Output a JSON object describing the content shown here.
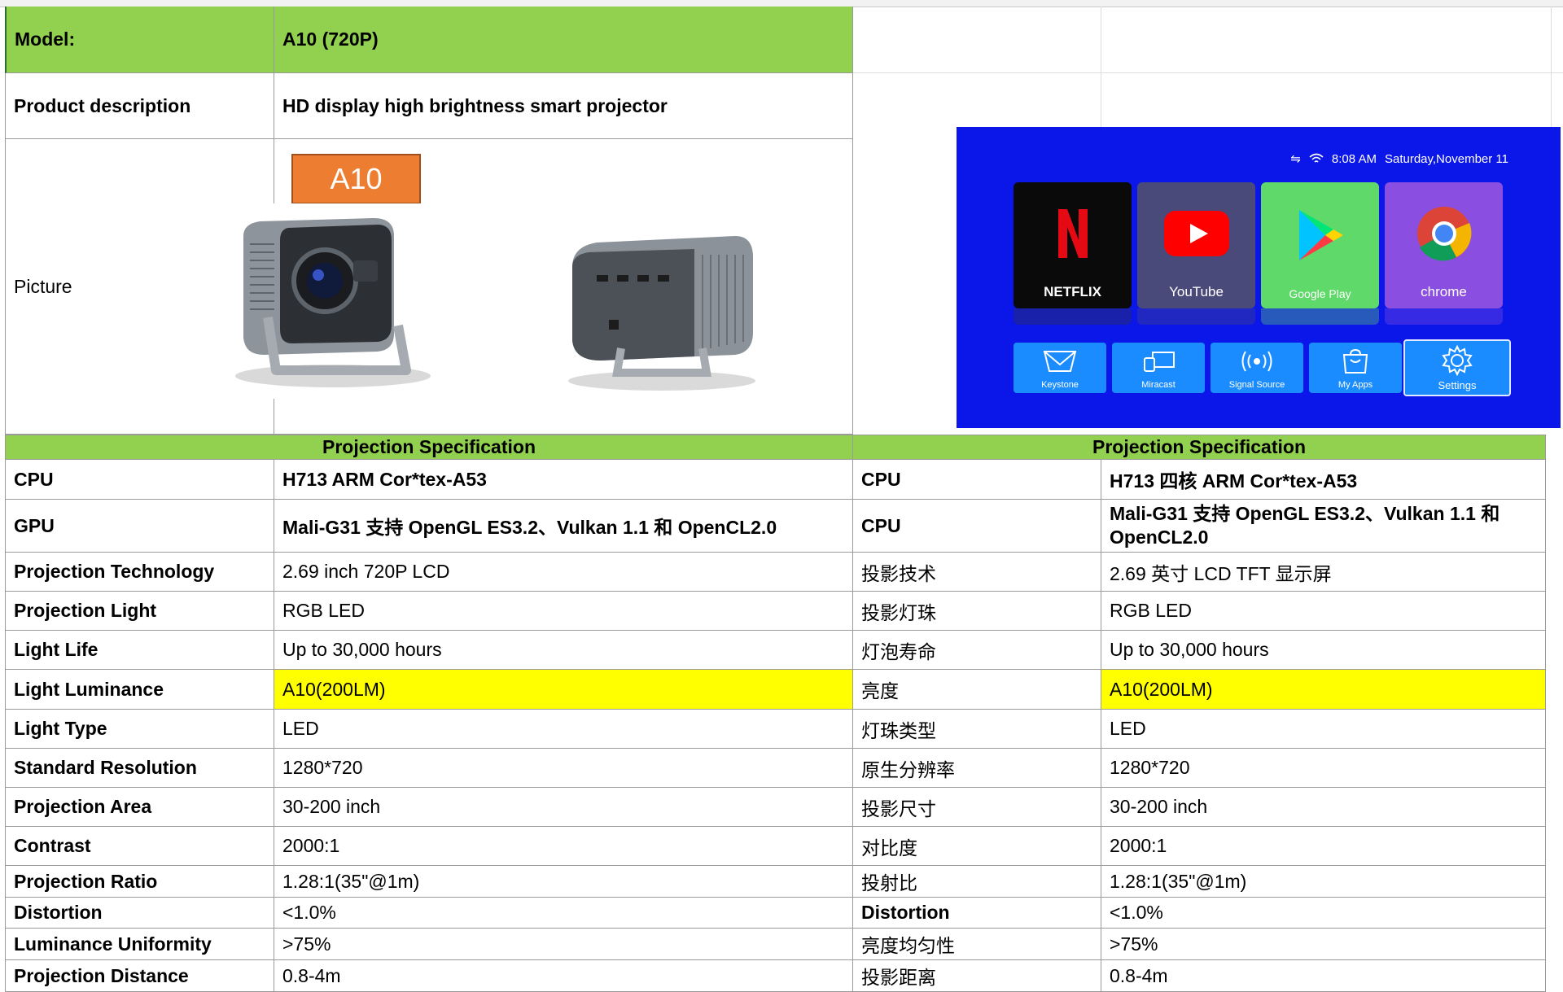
{
  "model": {
    "label": "Model:",
    "value": "A10 (720P)"
  },
  "description": {
    "label": "Product description",
    "value": "HD display high brightness smart projector"
  },
  "picture": {
    "label": "Picture",
    "badge": "A10"
  },
  "tv_ui": {
    "time": "8:08 AM",
    "date": "Saturday,November 11",
    "apps": [
      {
        "label": "NETFLIX",
        "color": "#0a0a0a"
      },
      {
        "label": "YouTube",
        "color": "#4a4a7a"
      },
      {
        "label": "Google Play",
        "color": "#5fd96a"
      },
      {
        "label": "chrome",
        "color": "#8a4fe0"
      }
    ],
    "buttons": [
      "Keystone",
      "Miracast",
      "Signal Source",
      "My Apps",
      "Settings"
    ]
  },
  "spec_header_left": "Projection Specification",
  "spec_header_right": "Projection Specification",
  "specs": [
    {
      "l_label": "CPU",
      "l_value": "H713  ARM Cor*tex-A53",
      "r_label": "CPU",
      "r_value": "H713 四核 ARM Cor*tex-A53",
      "bold_value": true
    },
    {
      "l_label": "GPU",
      "l_value": "Mali-G31 支持 OpenGL ES3.2、Vulkan 1.1 和 OpenCL2.0",
      "r_label": "CPU",
      "r_value": "Mali-G31 支持 OpenGL ES3.2、Vulkan 1.1 和 OpenCL2.0",
      "bold_value": true
    },
    {
      "l_label": "Projection Technology",
      "l_value": "2.69 inch 720P LCD",
      "r_label": "投影技术",
      "r_value": "2.69 英寸 LCD TFT 显示屏"
    },
    {
      "l_label": "Projection Light",
      "l_value": "RGB LED",
      "r_label": "投影灯珠",
      "r_value": "RGB LED"
    },
    {
      "l_label": "Light Life",
      "l_value": "Up to 30,000 hours",
      "r_label": " 灯泡寿命",
      "r_value": "Up to 30,000 hours"
    },
    {
      "l_label": "Light Luminance",
      "l_value": "A10(200LM)",
      "r_label": "亮度",
      "r_value": "A10(200LM)",
      "highlight": "#ffff00"
    },
    {
      "l_label": "Light Type",
      "l_value": "LED",
      "r_label": "灯珠类型",
      "r_value": "LED"
    },
    {
      "l_label": "Standard Resolution",
      "l_value": "1280*720",
      "r_label": "原生分辨率",
      "r_value": "1280*720"
    },
    {
      "l_label": "Projection Area",
      "l_value": "30-200 inch",
      "r_label": "投影尺寸",
      "r_value": "30-200 inch"
    },
    {
      "l_label": "Contrast",
      "l_value": "2000:1",
      "r_label": "对比度",
      "r_value": "2000:1"
    },
    {
      "l_label": "Projection Ratio",
      "l_value": "1.28:1(35\"@1m)",
      "r_label": "投射比",
      "r_value": "1.28:1(35\"@1m)"
    },
    {
      "l_label": "Distortion",
      "l_value": "<1.0%",
      "r_label": "Distortion",
      "r_value": "<1.0%"
    },
    {
      "l_label": "Luminance Uniformity",
      "l_value": ">75%",
      "r_label": "亮度均匀性",
      "r_value": ">75%"
    },
    {
      "l_label": "Projection Distance",
      "l_value": "0.8-4m",
      "r_label": "投影距离",
      "r_value": "0.8-4m"
    }
  ]
}
